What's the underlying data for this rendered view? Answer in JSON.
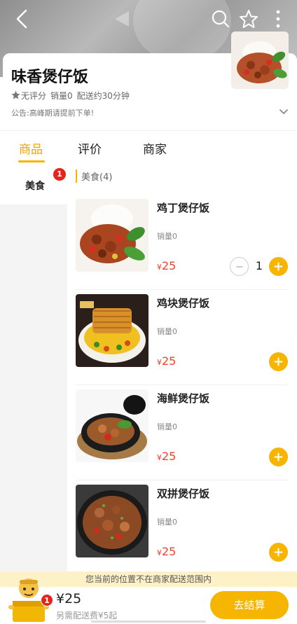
{
  "shop": {
    "name": "味香煲仔饭",
    "rating_text": "无评分",
    "sales_text": "销量0",
    "delivery_text": "配送约30分钟",
    "notice": "公告:高峰期请提前下单!"
  },
  "tabs": [
    {
      "label": "商品",
      "active": true
    },
    {
      "label": "评价",
      "active": false
    },
    {
      "label": "商家",
      "active": false
    }
  ],
  "sidebar": {
    "items": [
      {
        "label": "美食",
        "badge": "1"
      }
    ]
  },
  "category": {
    "title": "美食(4)"
  },
  "items": [
    {
      "name": "鸡丁煲仔饭",
      "sales": "销量0",
      "currency": "¥",
      "price": "25",
      "quantity": "1"
    },
    {
      "name": "鸡块煲仔饭",
      "sales": "销量0",
      "currency": "¥",
      "price": "25"
    },
    {
      "name": "海鲜煲仔饭",
      "sales": "销量0",
      "currency": "¥",
      "price": "25"
    },
    {
      "name": "双拼煲仔饭",
      "sales": "销量0",
      "currency": "¥",
      "price": "25"
    }
  ],
  "bottom": {
    "notice": "您当前的位置不在商家配送范围内",
    "cart_badge": "1",
    "total": "¥25",
    "delivery_hint": "另需配送费¥5起",
    "checkout_label": "去结算"
  },
  "colors": {
    "accent": "#f5b500",
    "price": "#f0412a",
    "badge": "#e8231e"
  },
  "icons": [
    "back-icon",
    "search-icon",
    "star-icon",
    "more-icon",
    "chevron-down-icon",
    "plus-icon",
    "minus-icon",
    "cart-icon"
  ]
}
